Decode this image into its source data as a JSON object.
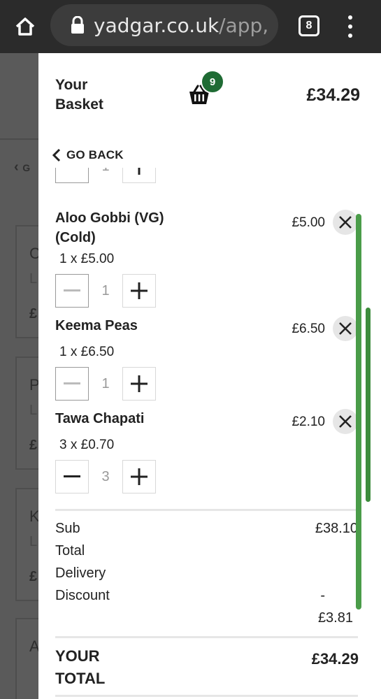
{
  "browser": {
    "url_host": "yadgar.co.uk",
    "url_path": "/app,",
    "tab_count": "8",
    "icons": [
      "home-icon",
      "lock-icon",
      "tabs-icon",
      "more-vert-icon"
    ]
  },
  "background": {
    "back_label": "G",
    "cards": [
      {
        "title": "C",
        "sub": "L",
        "price": "£"
      },
      {
        "title": "P",
        "sub": "L",
        "price": "£"
      },
      {
        "title": "K",
        "sub": "L",
        "price": "£"
      },
      {
        "title": "A",
        "sub": "",
        "price": ""
      }
    ]
  },
  "basket": {
    "title_line1": "Your",
    "title_line2": "Basket",
    "count": "9",
    "total": "£34.29",
    "go_back": "GO BACK",
    "accent_color": "#1f6b34",
    "scroll_color": "#4a9c49",
    "partial_qty": "1",
    "items": [
      {
        "name_line1": "Aloo Gobbi (VG)",
        "name_line2": "(Cold)",
        "unit": "1 x £5.00",
        "price": "£5.00",
        "qty": "1"
      },
      {
        "name_line1": "Keema Peas",
        "name_line2": "",
        "unit": "1 x £6.50",
        "price": "£6.50",
        "qty": "1"
      },
      {
        "name_line1": "Tawa Chapati",
        "name_line2": "",
        "unit": "3 x £0.70",
        "price": "£2.10",
        "qty": "3"
      }
    ],
    "summary": {
      "sub_label_1": "Sub",
      "sub_label_2": "Total",
      "sub_value": "£38.10",
      "delivery_label": "Delivery",
      "discount_label": "Discount",
      "discount_value_1": "-",
      "discount_value_2": "£3.81",
      "your_total_1": "YOUR",
      "your_total_2": "TOTAL",
      "your_total_value": "£34.29"
    }
  }
}
